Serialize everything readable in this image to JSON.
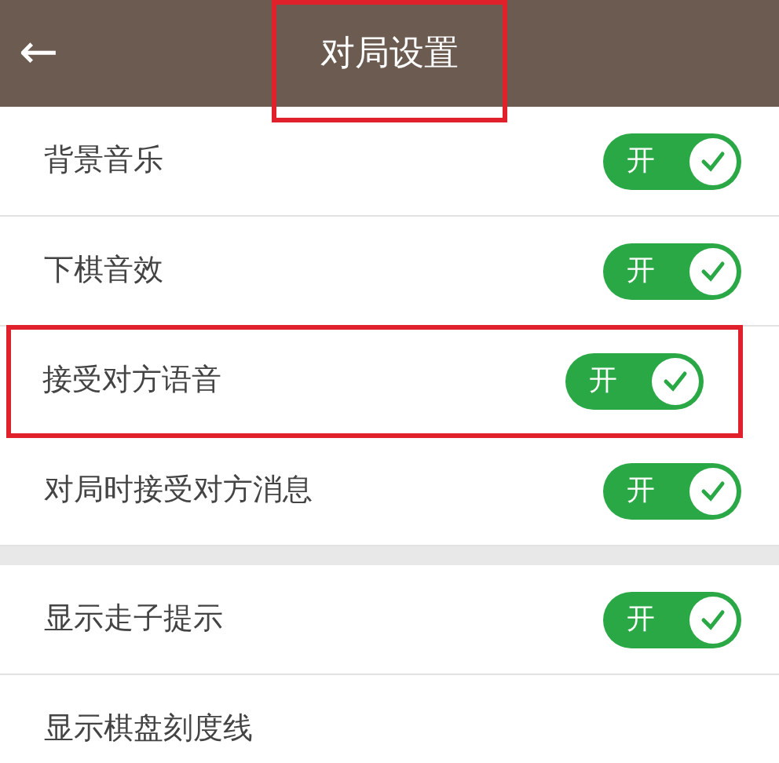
{
  "header": {
    "back": "←",
    "title": "对局设置",
    "highlighted": true
  },
  "groups": [
    {
      "rows": [
        {
          "label": "背景音乐",
          "toggle": {
            "on": true,
            "text": "开"
          },
          "highlighted": false
        },
        {
          "label": "下棋音效",
          "toggle": {
            "on": true,
            "text": "开"
          },
          "highlighted": false
        },
        {
          "label": "接受对方语音",
          "toggle": {
            "on": true,
            "text": "开"
          },
          "highlighted": true
        },
        {
          "label": "对局时接受对方消息",
          "toggle": {
            "on": true,
            "text": "开"
          },
          "highlighted": false
        }
      ]
    },
    {
      "rows": [
        {
          "label": "显示走子提示",
          "toggle": {
            "on": true,
            "text": "开"
          },
          "highlighted": false
        },
        {
          "label": "显示棋盘刻度线",
          "highlighted": false
        }
      ]
    }
  ]
}
